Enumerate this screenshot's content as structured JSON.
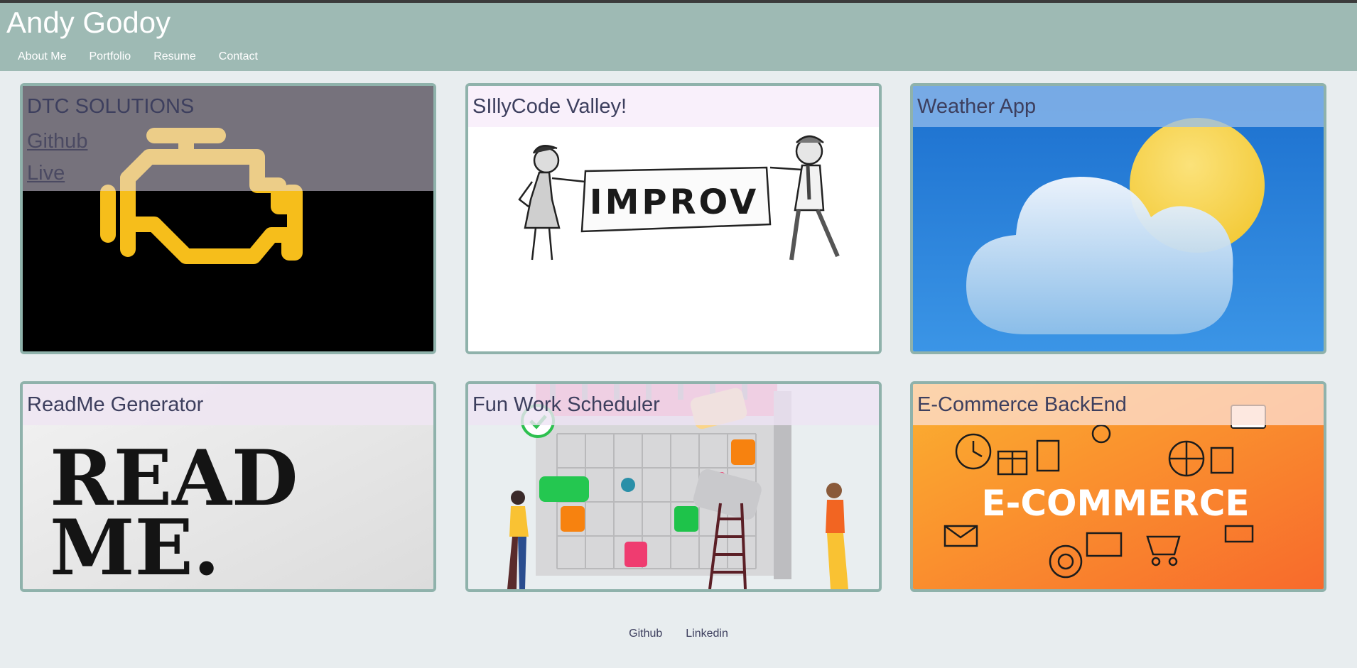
{
  "header": {
    "title": "Andy Godoy",
    "nav": [
      "About Me",
      "Portfolio",
      "Resume",
      "Contact"
    ]
  },
  "projects": [
    {
      "title": "DTC SOLUTIONS",
      "links": [
        "Github",
        "Live"
      ],
      "image_icon": "check-engine-icon"
    },
    {
      "title": "SIllyCode Valley!",
      "image_text": "IMPROV",
      "image_icon": "improv-banner-illustration"
    },
    {
      "title": "Weather App",
      "image_icon": "weather-cloud-sun-icon"
    },
    {
      "title": "ReadMe Generator",
      "image_text": [
        "READ",
        "ME."
      ],
      "image_icon": "readme-typewriter-art"
    },
    {
      "title": "Fun Work Scheduler",
      "image_icon": "calendar-scheduler-illustration"
    },
    {
      "title": "E-Commerce BackEnd",
      "image_text": "E-COMMERCE",
      "image_icon": "ecommerce-collage"
    }
  ],
  "footer": {
    "links": [
      "Github",
      "Linkedin"
    ]
  },
  "colors": {
    "header_bg": "#9ebab4",
    "page_bg": "#e8edef",
    "card_border": "#8fb2ab",
    "title_text": "#3d3f5e"
  }
}
